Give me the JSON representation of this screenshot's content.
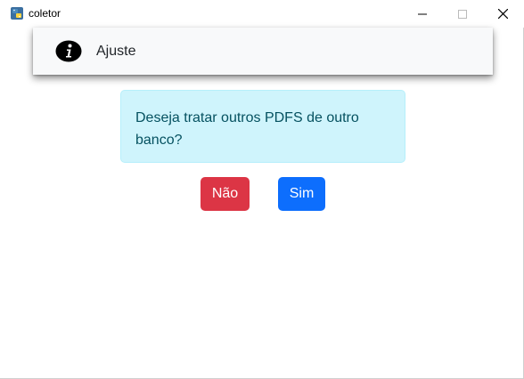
{
  "window": {
    "title": "coletor",
    "icon": "python-icon",
    "controls": [
      "minimize-icon",
      "maximize-icon",
      "close-icon"
    ]
  },
  "header": {
    "icon": "info-icon",
    "title": "Ajuste"
  },
  "message": {
    "text": "Deseja tratar outros PDFS de outro banco?"
  },
  "buttons": {
    "no_label": "Não",
    "yes_label": "Sim"
  },
  "colors": {
    "alert_background": "#cff4fc",
    "alert_text": "#055160",
    "no_button": "#dc3545",
    "yes_button": "#0d6efd",
    "header_background": "#f8f9fa"
  }
}
